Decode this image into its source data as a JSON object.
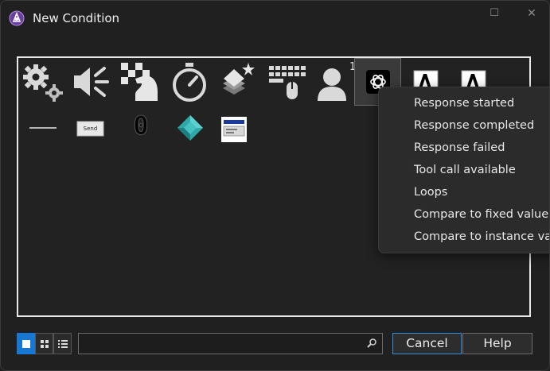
{
  "window": {
    "title": "New Condition",
    "maximize_glyph": "☐",
    "close_glyph": "✕"
  },
  "objects": {
    "row1": [
      {
        "name": "special-conditions-icon",
        "kind": "gears"
      },
      {
        "name": "sound-icon",
        "kind": "speaker"
      },
      {
        "name": "storyboard-icon",
        "kind": "chess"
      },
      {
        "name": "timer-icon",
        "kind": "stopwatch"
      },
      {
        "name": "create-objects-icon",
        "kind": "layers"
      },
      {
        "name": "keyboard-mouse-icon",
        "kind": "keyboard"
      },
      {
        "name": "player-icon",
        "kind": "person",
        "badge": "1"
      },
      {
        "name": "openai-icon",
        "kind": "openai",
        "selected": true
      },
      {
        "name": "text-object-icon-1",
        "kind": "text"
      },
      {
        "name": "text-object-icon-2",
        "kind": "text"
      }
    ],
    "row2": [
      {
        "name": "line-object-icon",
        "kind": "line"
      },
      {
        "name": "send-button-object-icon",
        "kind": "button",
        "label": "Send"
      },
      {
        "name": "counter-object-icon",
        "kind": "counter",
        "label": "0"
      },
      {
        "name": "active-gem-object-icon",
        "kind": "gem"
      },
      {
        "name": "window-control-object-icon",
        "kind": "window"
      }
    ]
  },
  "context_menu": {
    "items": [
      "Response started",
      "Response completed",
      "Response failed",
      "Tool call available",
      "Loops",
      "Compare to fixed value",
      "Compare to instance value"
    ]
  },
  "search": {
    "value": "",
    "placeholder": ""
  },
  "buttons": {
    "cancel": "Cancel",
    "help": "Help"
  },
  "colors": {
    "accent": "#1778d4",
    "background": "#202020",
    "panel": "#222222"
  }
}
